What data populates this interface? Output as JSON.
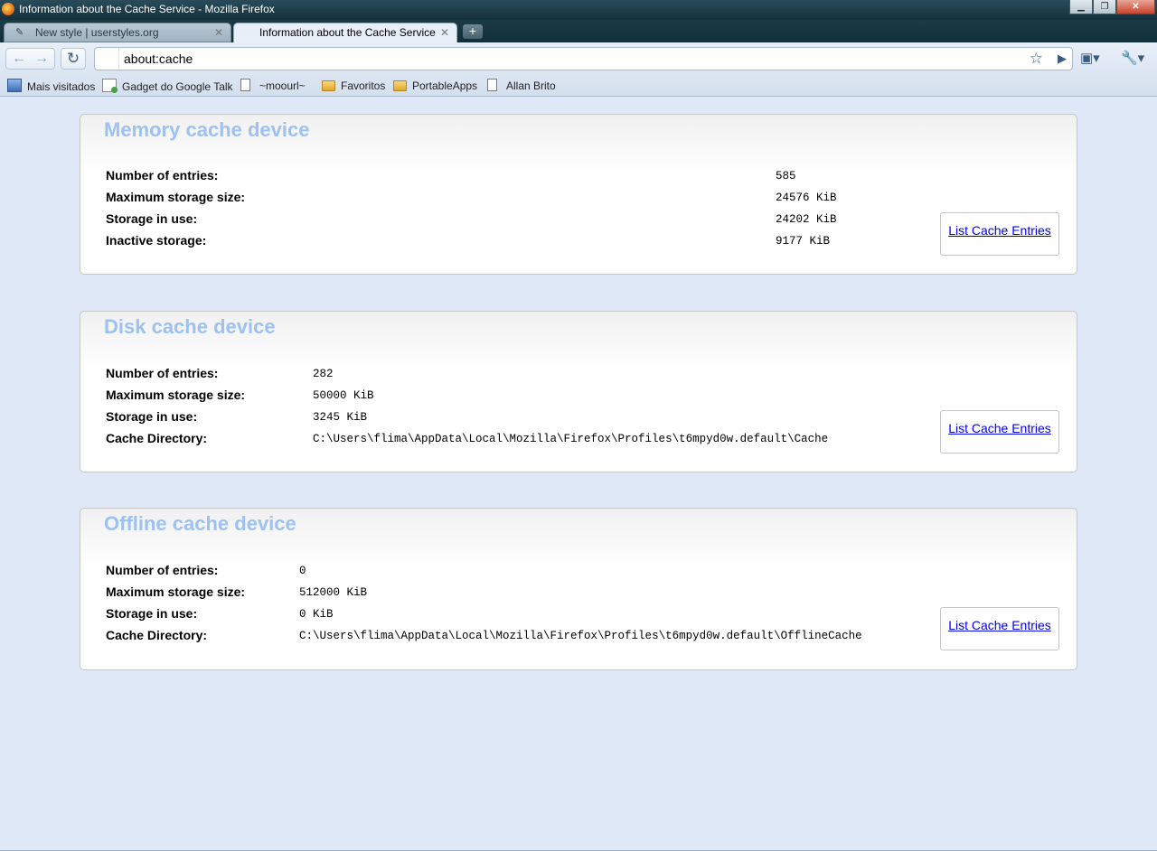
{
  "window": {
    "title": "Information about the Cache Service - Mozilla Firefox"
  },
  "tabs": [
    {
      "label": "New style | userstyles.org",
      "active": false
    },
    {
      "label": "Information about the Cache Service",
      "active": true
    }
  ],
  "toolbar": {
    "url": "about:cache"
  },
  "bookmarks": [
    {
      "label": "Mais visitados",
      "icon": "most-visited-icon"
    },
    {
      "label": "Gadget do Google Talk",
      "icon": "gadget-icon"
    },
    {
      "label": "~moourl~",
      "icon": "page-icon"
    },
    {
      "label": "Favoritos",
      "icon": "folder-icon"
    },
    {
      "label": "PortableApps",
      "icon": "folder-icon"
    },
    {
      "label": "Allan Brito",
      "icon": "page-icon"
    }
  ],
  "devices": [
    {
      "title": "Memory cache device",
      "rows": [
        {
          "label": "Number of entries:",
          "value": "585"
        },
        {
          "label": "Maximum storage size:",
          "value": "24576 KiB"
        },
        {
          "label": "Storage in use:",
          "value": "24202 KiB"
        },
        {
          "label": "Inactive storage:",
          "value": "9177 KiB"
        }
      ],
      "button": "List Cache Entries"
    },
    {
      "title": "Disk cache device",
      "rows": [
        {
          "label": "Number of entries:",
          "value": "282"
        },
        {
          "label": "Maximum storage size:",
          "value": "50000 KiB"
        },
        {
          "label": "Storage in use:",
          "value": "3245 KiB"
        },
        {
          "label": "Cache Directory:",
          "value": "C:\\Users\\flima\\AppData\\Local\\Mozilla\\Firefox\\Profiles\\t6mpyd0w.default\\Cache"
        }
      ],
      "button": "List Cache Entries"
    },
    {
      "title": "Offline cache device",
      "rows": [
        {
          "label": "Number of entries:",
          "value": "0"
        },
        {
          "label": "Maximum storage size:",
          "value": "512000 KiB"
        },
        {
          "label": "Storage in use:",
          "value": "0 KiB"
        },
        {
          "label": "Cache Directory:",
          "value": "C:\\Users\\flima\\AppData\\Local\\Mozilla\\Firefox\\Profiles\\t6mpyd0w.default\\OfflineCache"
        }
      ],
      "button": "List Cache Entries"
    }
  ]
}
